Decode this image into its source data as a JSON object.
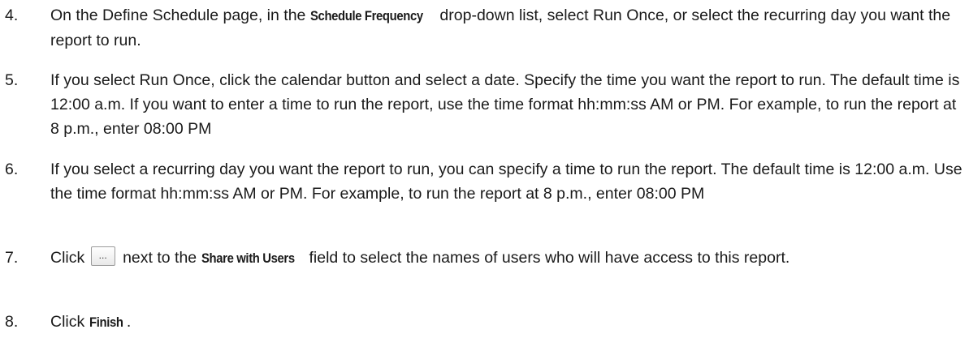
{
  "steps": [
    {
      "number": "4.",
      "pre": "On the Define Schedule page, in the ",
      "bold": "Schedule Frequency",
      "post": " drop-down list, select Run Once, or select the recurring day you want the report to run."
    },
    {
      "number": "5.",
      "text": "If you select Run Once, click the calendar button and select a date. Specify the time you want the report to run. The default time is 12:00 a.m. If you want to enter a time to run the report, use the time format hh:mm:ss AM or PM. For example, to run the report at 8 p.m., enter 08:00 PM"
    },
    {
      "number": "6.",
      "text": "If you select a recurring day you want the report to run, you can specify a time to run the report. The default time is 12:00 a.m. Use the time format hh:mm:ss AM or PM. For example, to run the report at 8 p.m., enter 08:00 PM"
    },
    {
      "number": "7.",
      "pre": "Click ",
      "button_glyph": "...",
      "mid": " next to the ",
      "bold": "Share with Users",
      "post": " field to select the names of users who will have access to this report."
    },
    {
      "number": "8.",
      "pre": "Click ",
      "bold": "Finish",
      "post": "."
    }
  ],
  "icons": {
    "browse_button": "ellipsis-button-icon"
  }
}
